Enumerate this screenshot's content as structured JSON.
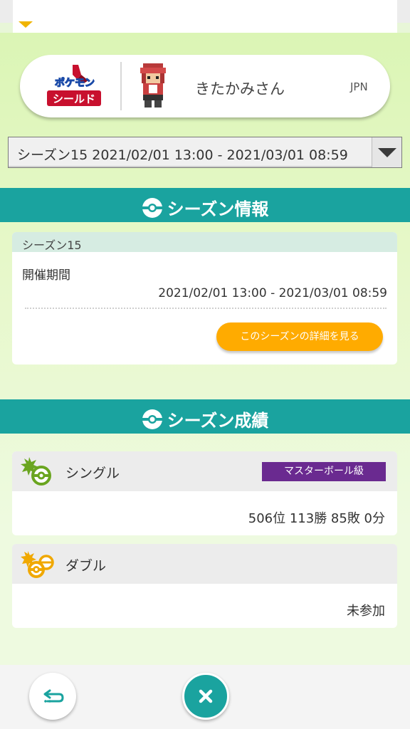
{
  "player": {
    "game_logo_text_top": "ポケットモンスター",
    "game_logo_text_bottom": "シールド",
    "name": "きたかみさん",
    "region": "JPN"
  },
  "season_select": {
    "selected": "シーズン15 2021/02/01 13:00 - 2021/03/01 08:59"
  },
  "season_info": {
    "title": "シーズン情報",
    "season_name": "シーズン15",
    "period_label": "開催期間",
    "period_value": "2021/02/01 13:00 - 2021/03/01 08:59",
    "detail_button": "このシーズンの詳細を見る"
  },
  "season_results": {
    "title": "シーズン成績",
    "single": {
      "label": "シングル",
      "rank_badge": "マスターボール級",
      "value": "506位 113勝 85敗 0分"
    },
    "double": {
      "label": "ダブル",
      "value": "未参加"
    }
  },
  "bottom_bar": {
    "back_icon": "back-arrow-icon",
    "close_icon": "close-icon"
  },
  "colors": {
    "teal": "#1aa39f",
    "orange": "#ffab00",
    "purple": "#6a2a90",
    "green_bg": "#dbf5b5"
  }
}
